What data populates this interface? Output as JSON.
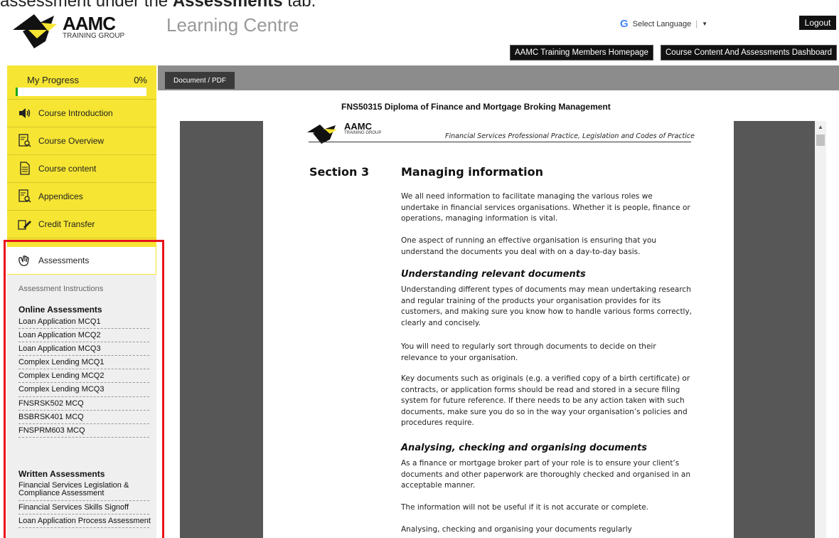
{
  "caption": {
    "prefix": "assessment under the ",
    "bold": "Assessments",
    "suffix": " tab."
  },
  "header": {
    "logo_main": "AAMC",
    "logo_sub": "TRAINING GROUP",
    "title": "Learning Centre",
    "language_label": "Select Language",
    "language_caret": "▼",
    "logout_label": "Logout",
    "members_btn": "AAMC Training Members Homepage",
    "dashboard_btn": "Course Content And Assessments Dashboard"
  },
  "sidebar": {
    "progress_label": "My Progress",
    "progress_value": "0%",
    "progress_fraction": 0,
    "items": [
      {
        "label": "Course Introduction",
        "icon": "speaker-icon"
      },
      {
        "label": "Course Overview",
        "icon": "document-search-icon"
      },
      {
        "label": "Course content",
        "icon": "document-icon"
      },
      {
        "label": "Appendices",
        "icon": "document-search-icon"
      },
      {
        "label": "Credit Transfer",
        "icon": "transfer-icon"
      }
    ],
    "assessments_label": "Assessments",
    "assessment_instructions": "Assessment Instructions",
    "online_heading": "Online Assessments",
    "online": [
      "Loan Application MCQ1",
      "Loan Application MCQ2",
      "Loan Application MCQ3",
      "Complex Lending MCQ1",
      "Complex Lending MCQ2",
      "Complex Lending MCQ3",
      "FNSRSK502 MCQ",
      "BSBRSK401 MCQ",
      "FNSPRM603 MCQ"
    ],
    "written_heading": "Written Assessments",
    "written": [
      "Financial Services Legislation & Compliance Assessment",
      "Financial Services Skills Signoff",
      "Loan Application Process Assessment"
    ]
  },
  "content": {
    "tab_label": "Document / PDF",
    "course_title": "FNS50315 Diploma of Finance and Mortgage Broking Management"
  },
  "document": {
    "logo_main": "AAMC",
    "logo_sub": "TRAINING GROUP",
    "header": "Financial Services Professional Practice, Legislation and Codes of Practice",
    "section_label": "Section 3",
    "section_title": "Managing information",
    "p1": "We all need information to facilitate managing the various roles we undertake in financial services organisations.  Whether it is people, finance or operations, managing information is vital.",
    "p2": "One aspect of running an effective organisation is ensuring that you understand the documents you deal with on a day-to-day basis.",
    "h1": "Understanding relevant documents",
    "p3": "Understanding different types of documents may mean undertaking research and regular training of the products your organisation provides for its customers, and making sure you know how to handle various forms correctly, clearly and concisely.",
    "p4": "You will need to regularly sort through documents to decide on their relevance to your organisation.",
    "p5": "Key documents such as originals (e.g. a verified copy of a birth certificate) or contracts, or application forms should be read and stored in a secure filing system for future reference.  If there needs to be any action taken with such documents, make sure you do so in the way your organisation’s policies and procedures require.",
    "h2": "Analysing, checking and organising documents",
    "p6": "As a finance or mortgage broker part of your role is to ensure your client’s documents and other paperwork are thoroughly checked and organised in an acceptable manner.",
    "p7": "The information will not be useful if it is not accurate or complete.",
    "p8": "Analysing, checking and organising your documents regularly"
  },
  "colors": {
    "sidebar": "#f6e533",
    "highlight": "#e8131b",
    "progress": "#18a81a"
  }
}
